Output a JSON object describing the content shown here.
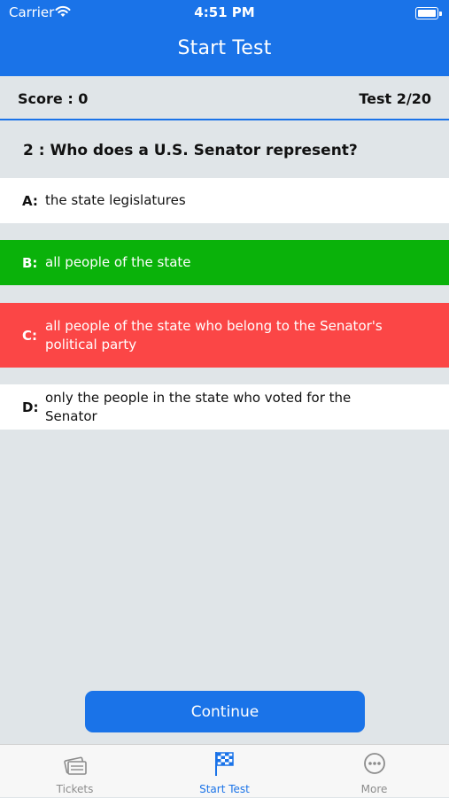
{
  "status_bar": {
    "carrier": "Carrier",
    "time": "4:51 PM"
  },
  "header": {
    "title": "Start Test"
  },
  "score_bar": {
    "score": "Score : 0",
    "test": "Test 2/20"
  },
  "question": {
    "text": "2 : Who does a U.S. Senator represent?"
  },
  "answers": [
    {
      "letter": "A:",
      "text": "the state legislatures",
      "state": "neutral"
    },
    {
      "letter": "B:",
      "text": "all people of the state",
      "state": "correct"
    },
    {
      "letter": "C:",
      "text": "all people of the state who belong to the Senator's political party",
      "state": "wrong"
    },
    {
      "letter": "D:",
      "text": "only the people in the state who voted for the Senator",
      "state": "neutral"
    }
  ],
  "continue_button": {
    "label": "Continue"
  },
  "tabs": [
    {
      "label": "Tickets",
      "icon": "tickets-icon",
      "active": false
    },
    {
      "label": "Start Test",
      "icon": "checkered-flag-icon",
      "active": true
    },
    {
      "label": "More",
      "icon": "more-icon",
      "active": false
    }
  ],
  "colors": {
    "accent": "#1a73e8",
    "correct": "#0ab20a",
    "wrong": "#fb4646",
    "background": "#e0e5e8",
    "tab_inactive": "#8c8c8c"
  }
}
